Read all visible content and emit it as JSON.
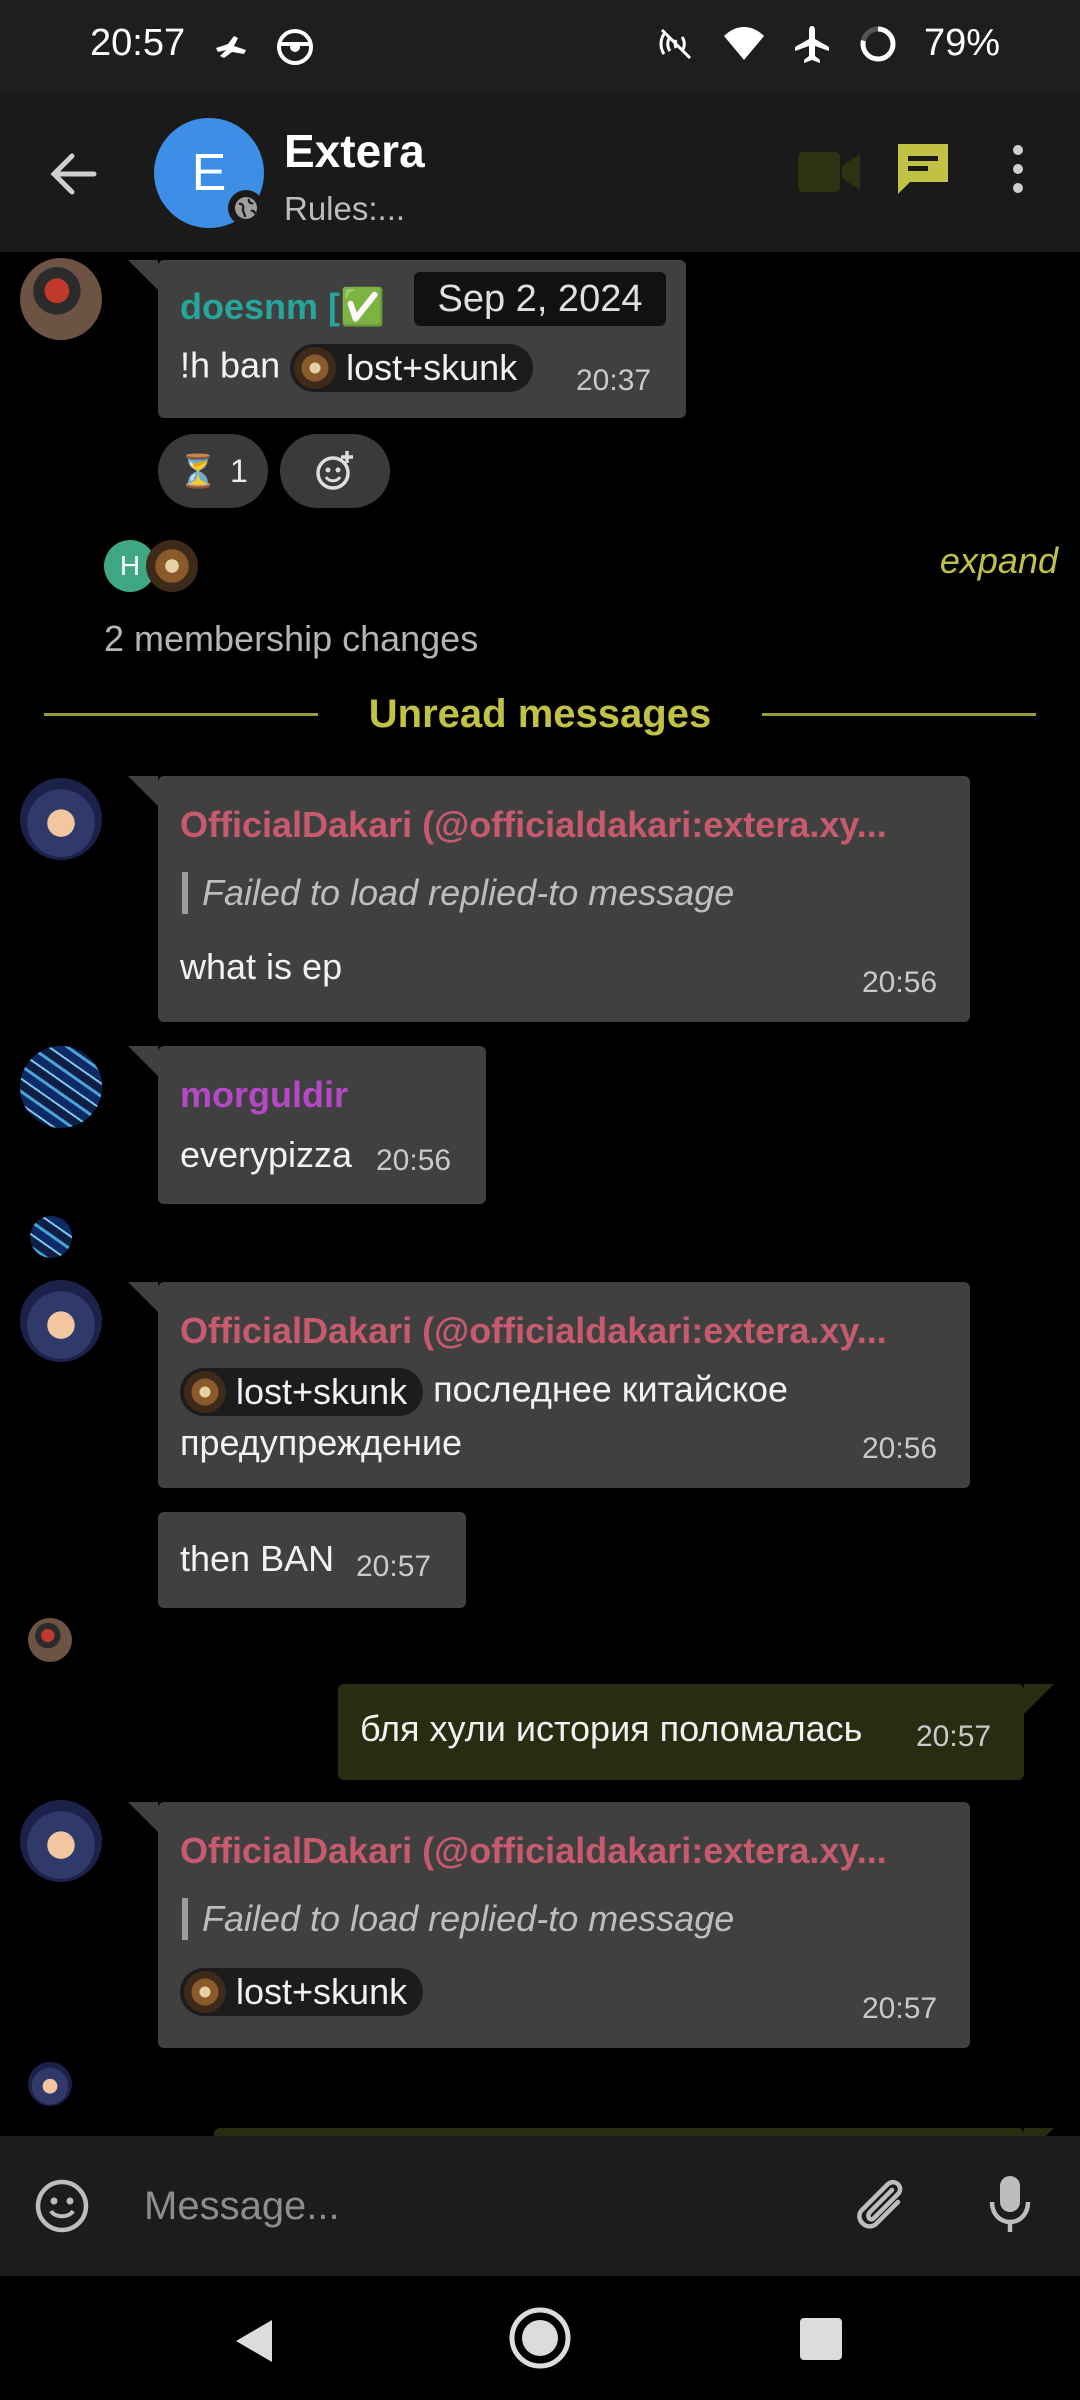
{
  "status_bar": {
    "time": "20:57",
    "battery": "79%",
    "icons": [
      "drone-icon",
      "steering-wheel-icon",
      "nfc-off-icon",
      "wifi-icon",
      "airplane-icon",
      "battery-ring-icon"
    ]
  },
  "header": {
    "avatar_letter": "E",
    "title": "Extera",
    "topic": "Rules:..."
  },
  "timeline": {
    "date_chip": "Sep 2, 2024",
    "messages": [
      {
        "sender": "doesnm [✅",
        "sender_color": "#26a69a",
        "text_prefix": "!h ban",
        "mention": "lost+skunk",
        "time": "20:37",
        "reactions": [
          {
            "emoji": "⏳",
            "count": "1"
          }
        ]
      },
      {
        "sender": "OfficialDakari (@officialdakari:extera.xy...",
        "sender_color": "#c85a6e",
        "reply": "Failed to load replied-to message",
        "text": "what is ep",
        "time": "20:56"
      },
      {
        "sender": "morguldir",
        "sender_color": "#b548c6",
        "text": "everypizza",
        "time": "20:56"
      },
      {
        "sender": "OfficialDakari (@officialdakari:extera.xy...",
        "sender_color": "#c85a6e",
        "mention": "lost+skunk",
        "text_line1": "последнее китайское",
        "text_line2": "предупреждение",
        "time": "20:56"
      },
      {
        "text": "then BAN",
        "time": "20:57"
      },
      {
        "own": true,
        "text": "бля хули история поломалась",
        "time": "20:57"
      },
      {
        "sender": "OfficialDakari (@officialdakari:extera.xy...",
        "sender_color": "#c85a6e",
        "reply": "Failed to load replied-to message",
        "mention": "lost+skunk",
        "time": "20:57"
      }
    ],
    "membership": {
      "avatar_letter": "H",
      "expand": "expand",
      "summary": "2 membership changes"
    },
    "unread_divider": "Unread messages"
  },
  "composer": {
    "placeholder": "Message..."
  },
  "colors": {
    "accent": "#c1c146",
    "bubble": "#404040",
    "own_bubble": "#2a2c12",
    "header_avatar": "#3d8fe6"
  }
}
